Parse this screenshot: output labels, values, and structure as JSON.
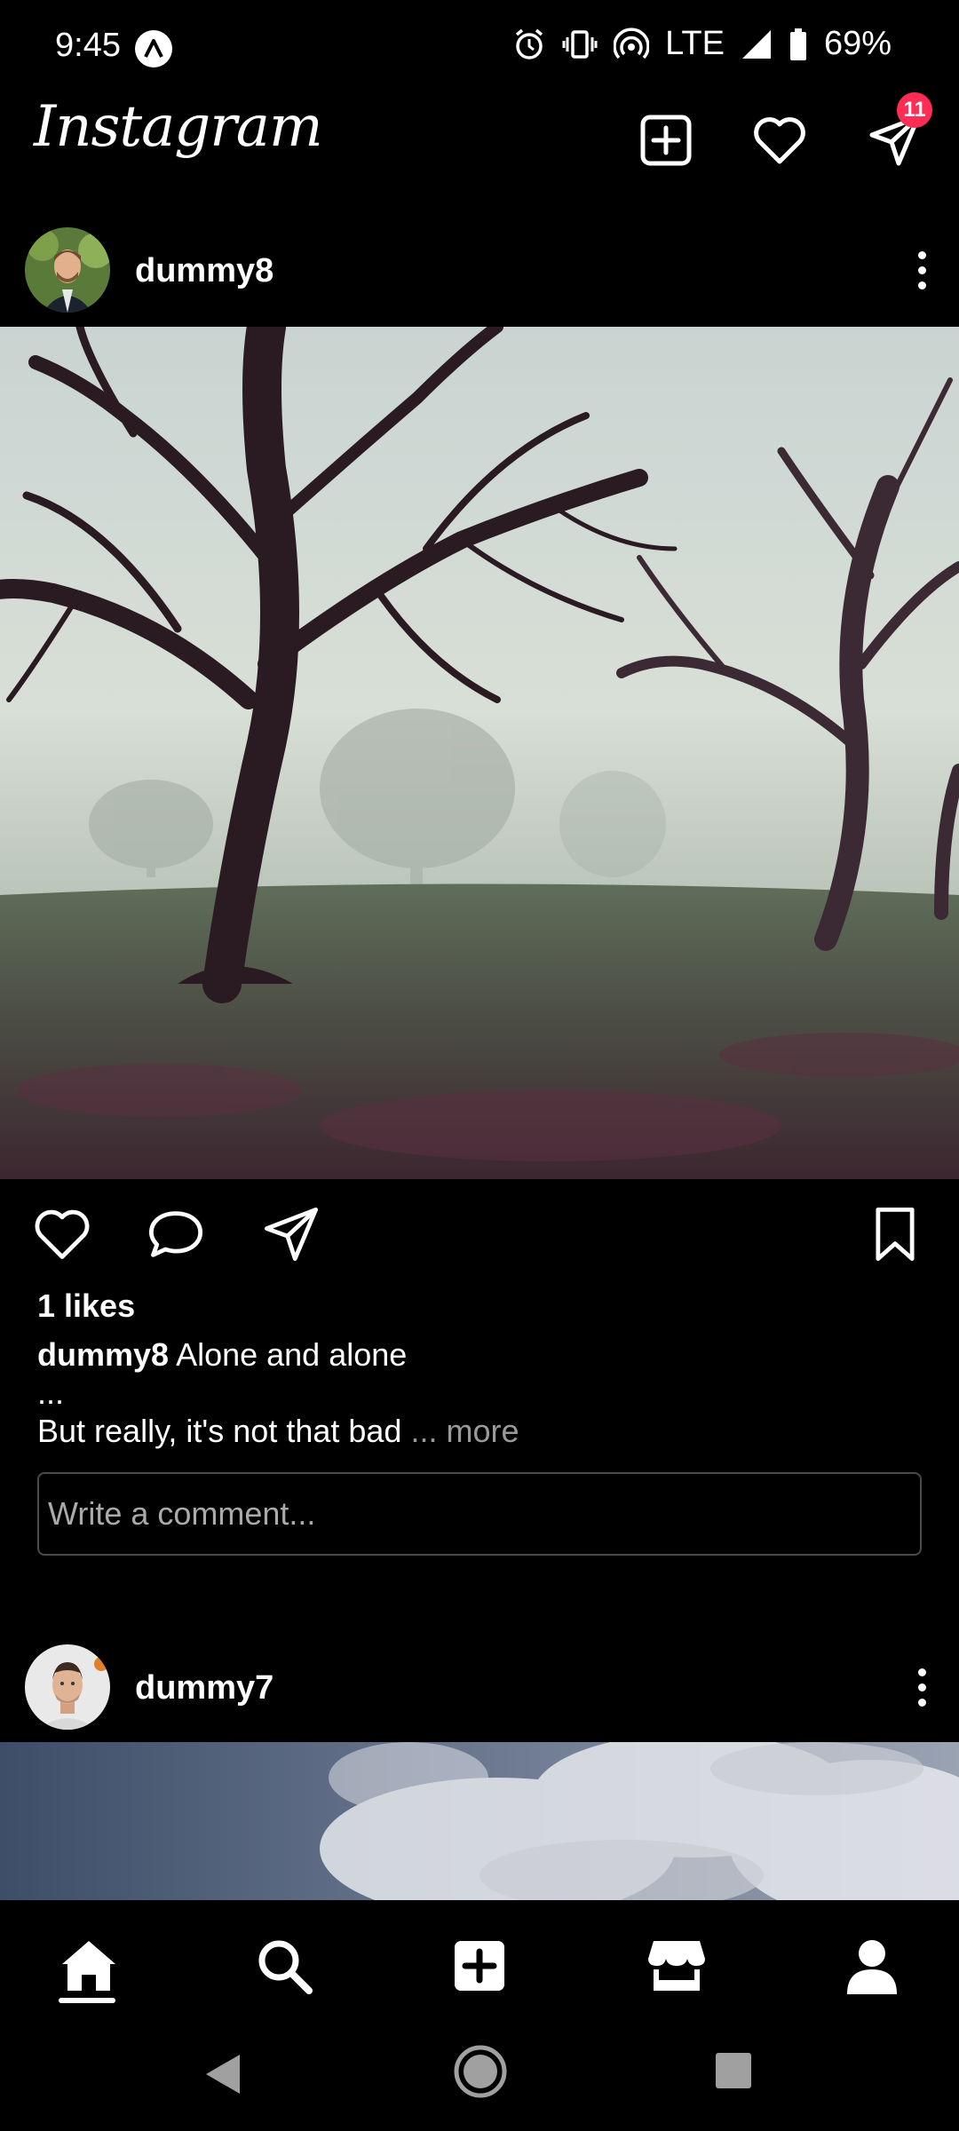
{
  "status_bar": {
    "time": "9:45",
    "network": "LTE",
    "battery": "69%",
    "icons": [
      "alarm-icon",
      "vibrate-icon",
      "hotspot-icon",
      "signal-icon",
      "battery-icon"
    ]
  },
  "app_bar": {
    "logo": "Instagram",
    "messages_badge": "11",
    "icons": [
      "add-post-icon",
      "heart-icon",
      "direct-message-icon"
    ]
  },
  "posts": [
    {
      "username": "dummy8",
      "likes": "1 likes",
      "caption_user": "dummy8",
      "caption_line1": "Alone and alone",
      "caption_line2": "...",
      "caption_line3": "But really, it's not that bad",
      "more": "... more",
      "comment_placeholder": "Write a comment..."
    },
    {
      "username": "dummy7"
    }
  ],
  "bottom_nav": {
    "items": [
      "home-icon",
      "search-icon",
      "add-icon",
      "shop-icon",
      "profile-icon"
    ],
    "active": "home"
  },
  "colors": {
    "background": "#000000",
    "badge": "#ff2d55",
    "muted_text": "#9a9a9a"
  }
}
